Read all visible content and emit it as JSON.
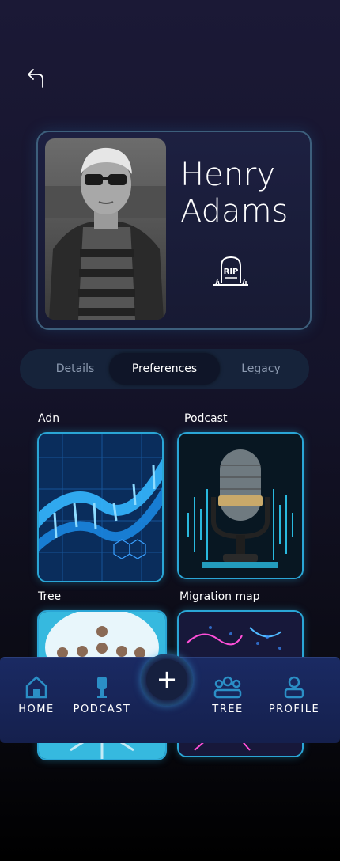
{
  "profile": {
    "first_name": "Henry",
    "last_name": "Adams",
    "rip_text": "RIP"
  },
  "tabs": [
    {
      "label": "Details",
      "active": false
    },
    {
      "label": "Preferences",
      "active": true
    },
    {
      "label": "Legacy",
      "active": false
    }
  ],
  "tiles": [
    {
      "label": "Adn"
    },
    {
      "label": "Podcast"
    },
    {
      "label": "Tree"
    },
    {
      "label": "Migration map"
    }
  ],
  "nav": {
    "home": "HOME",
    "podcast": "PODCAST",
    "tree": "TREE",
    "profile": "PROFILE",
    "add": "+"
  },
  "colors": {
    "accent": "#2aa6d6",
    "background": "#141329",
    "nav_background": "#1a2a63"
  }
}
